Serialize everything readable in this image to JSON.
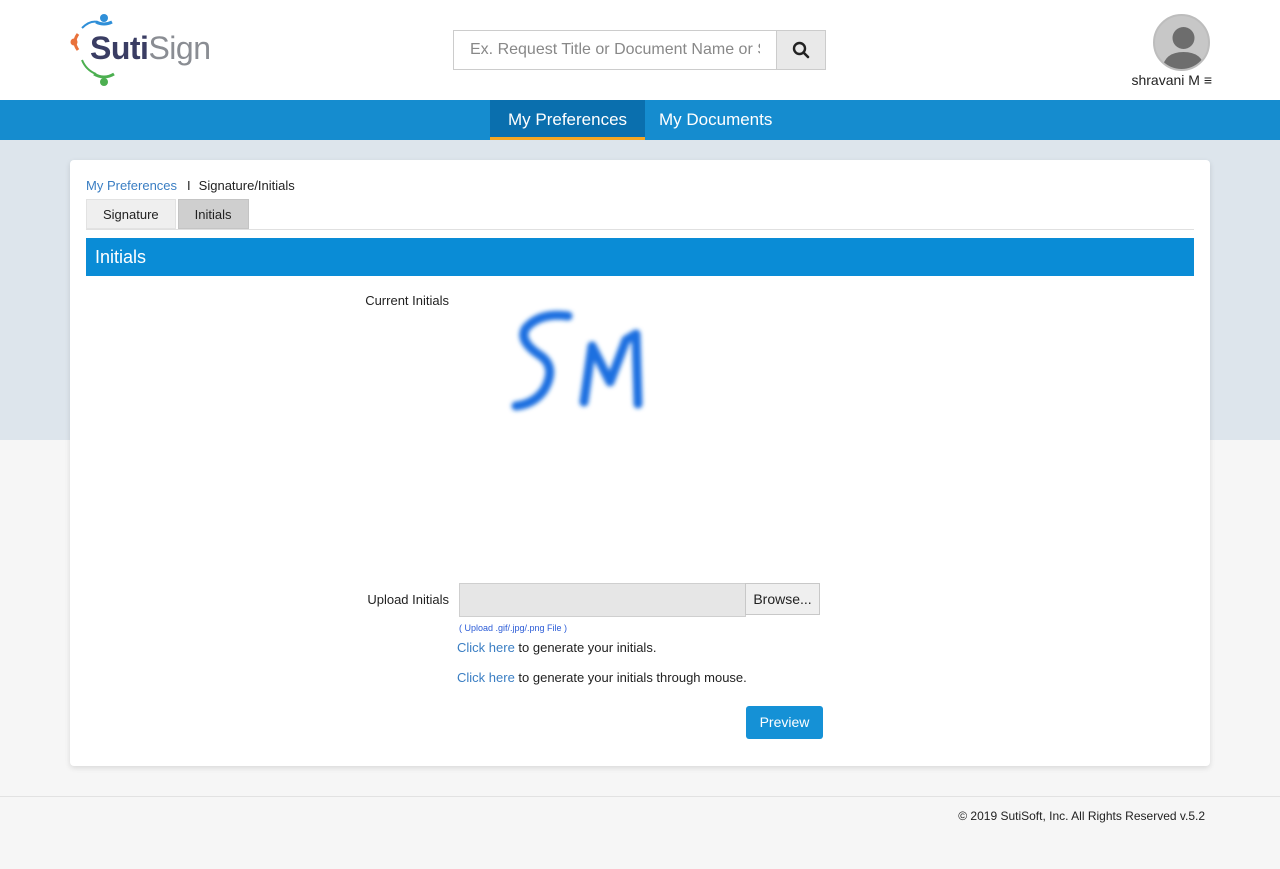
{
  "header": {
    "logo": {
      "part1": "S",
      "part2": "uti",
      "part3": "Sign"
    },
    "search": {
      "placeholder": "Ex. Request Title or Document Name or S"
    },
    "search_icon": "search-icon",
    "user": {
      "name": "shravani M",
      "menu_icon": "≡"
    }
  },
  "nav": {
    "items": [
      {
        "label": "My Preferences",
        "active": true
      },
      {
        "label": "My Documents",
        "active": false
      }
    ]
  },
  "breadcrumb": {
    "link": "My Preferences",
    "separator": "I",
    "current": "Signature/Initials"
  },
  "tabs": [
    {
      "label": "Signature",
      "active": false
    },
    {
      "label": "Initials",
      "active": true
    }
  ],
  "section": {
    "title": "Initials"
  },
  "form": {
    "current_label": "Current Initials",
    "current_initials_image": "SM",
    "upload_label": "Upload Initials",
    "browse_label": "Browse...",
    "file_hint": "( Upload .gif/.jpg/.png File )",
    "generate": {
      "link": "Click here",
      "text": " to generate your initials."
    },
    "mouse": {
      "link": "Click here",
      "text": " to generate your initials through mouse."
    },
    "preview_label": "Preview"
  },
  "footer": {
    "copyright": "© 2019 SutiSoft, Inc. All Rights Reserved v.5.2"
  },
  "colors": {
    "primary": "#158ccf",
    "active_nav": "#0a6fae",
    "accent": "#f5a623",
    "link": "#3a7ec3",
    "section_bar": "#0a8cd6"
  }
}
